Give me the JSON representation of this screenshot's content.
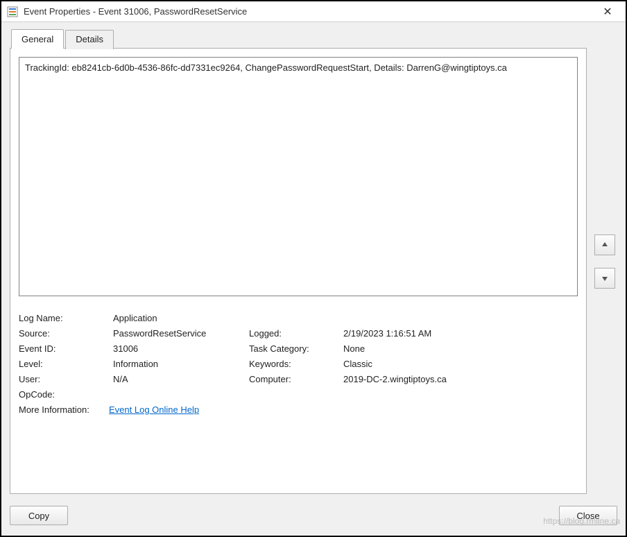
{
  "window": {
    "title": "Event Properties - Event 31006, PasswordResetService",
    "close_glyph": "✕"
  },
  "tabs": {
    "general": "General",
    "details": "Details"
  },
  "description": "TrackingId: eb8241cb-6d0b-4536-86fc-dd7331ec9264, ChangePasswordRequestStart, Details: DarrenG@wingtiptoys.ca",
  "fields": {
    "log_name_label": "Log Name:",
    "log_name_value": "Application",
    "source_label": "Source:",
    "source_value": "PasswordResetService",
    "logged_label": "Logged:",
    "logged_value": "2/19/2023 1:16:51 AM",
    "event_id_label": "Event ID:",
    "event_id_value": "31006",
    "task_category_label": "Task Category:",
    "task_category_value": "None",
    "level_label": "Level:",
    "level_value": "Information",
    "keywords_label": "Keywords:",
    "keywords_value": "Classic",
    "user_label": "User:",
    "user_value": "N/A",
    "computer_label": "Computer:",
    "computer_value": "2019-DC-2.wingtiptoys.ca",
    "opcode_label": "OpCode:",
    "opcode_value": "",
    "more_info_label": "More Information:",
    "more_info_link": "Event Log Online Help"
  },
  "buttons": {
    "copy": "Copy",
    "close": "Close"
  },
  "watermark": "https://blog.rmilne.ca"
}
